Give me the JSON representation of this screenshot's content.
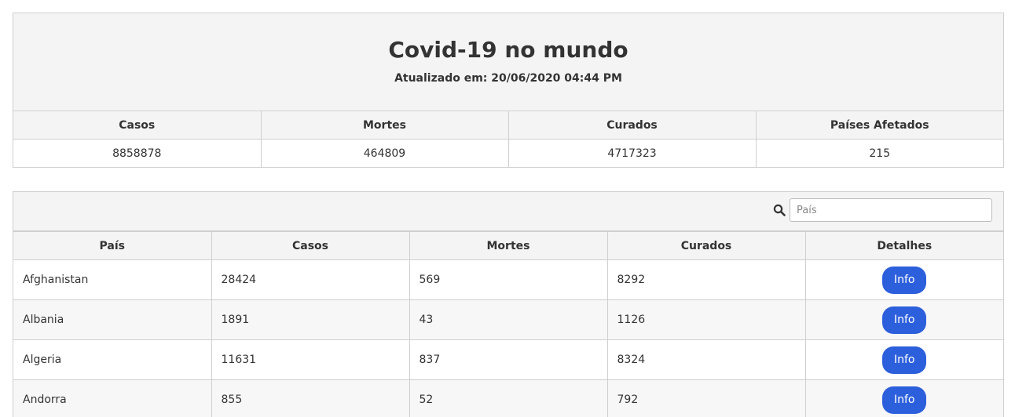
{
  "header": {
    "title": "Covid-19 no mundo",
    "updated": "Atualizado em: 20/06/2020 04:44 PM"
  },
  "summary": {
    "columns": [
      "Casos",
      "Mortes",
      "Curados",
      "Países Afetados"
    ],
    "values": [
      "8858878",
      "464809",
      "4717323",
      "215"
    ]
  },
  "search": {
    "icon": "search-icon",
    "placeholder": "País"
  },
  "countries": {
    "columns": [
      "País",
      "Casos",
      "Mortes",
      "Curados",
      "Detalhes"
    ],
    "button_label": "Info",
    "rows": [
      [
        "Afghanistan",
        "28424",
        "569",
        "8292"
      ],
      [
        "Albania",
        "1891",
        "43",
        "1126"
      ],
      [
        "Algeria",
        "11631",
        "837",
        "8324"
      ],
      [
        "Andorra",
        "855",
        "52",
        "792"
      ]
    ]
  },
  "colors": {
    "accent": "#2c5fdb",
    "panel_bg": "#f4f4f4",
    "border": "#cfcfcf"
  }
}
